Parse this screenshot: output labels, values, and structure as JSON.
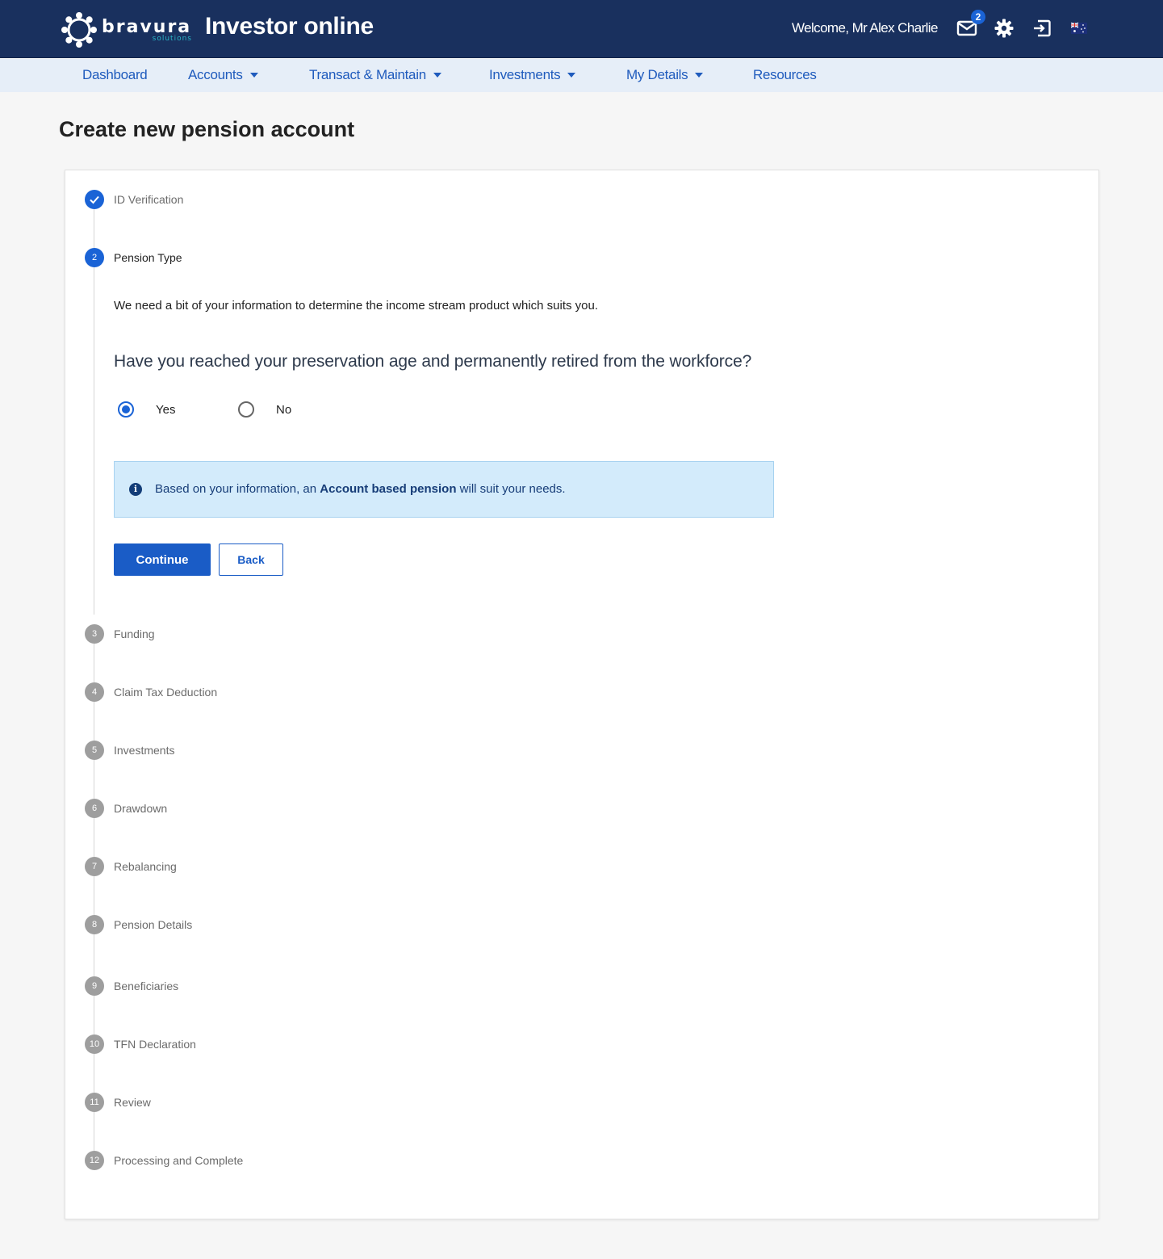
{
  "header": {
    "logo_name": "bravura",
    "logo_sub": "solutions",
    "app_title": "Investor online",
    "welcome": "Welcome, Mr Alex Charlie",
    "mail_count": "2",
    "icons": [
      "mail-icon",
      "gear-icon",
      "logout-icon",
      "australia-flag-icon"
    ]
  },
  "nav": {
    "items": [
      {
        "label": "Dashboard",
        "dropdown": false
      },
      {
        "label": "Accounts",
        "dropdown": true
      },
      {
        "label": "Transact & Maintain",
        "dropdown": true
      },
      {
        "label": "Investments",
        "dropdown": true
      },
      {
        "label": "My Details",
        "dropdown": true
      },
      {
        "label": "Resources",
        "dropdown": false
      }
    ]
  },
  "page": {
    "title": "Create new pension account"
  },
  "stepper": {
    "steps": [
      {
        "number": "1",
        "label": "ID Verification",
        "state": "done"
      },
      {
        "number": "2",
        "label": "Pension Type",
        "state": "active"
      },
      {
        "number": "3",
        "label": "Funding",
        "state": "pending"
      },
      {
        "number": "4",
        "label": "Claim Tax Deduction",
        "state": "pending"
      },
      {
        "number": "5",
        "label": "Investments",
        "state": "pending"
      },
      {
        "number": "6",
        "label": "Drawdown",
        "state": "pending"
      },
      {
        "number": "7",
        "label": "Rebalancing",
        "state": "pending"
      },
      {
        "number": "8",
        "label": "Pension Details",
        "state": "pending"
      },
      {
        "number": "9",
        "label": "Beneficiaries",
        "state": "pending"
      },
      {
        "number": "10",
        "label": "TFN Declaration",
        "state": "pending"
      },
      {
        "number": "11",
        "label": "Review",
        "state": "pending"
      },
      {
        "number": "12",
        "label": "Processing and Complete",
        "state": "pending"
      }
    ]
  },
  "form": {
    "intro": "We need a bit of your information to determine the income stream product which suits you.",
    "question": "Have you reached your preservation age and permanently retired from the workforce?",
    "options": [
      {
        "label": "Yes",
        "selected": true
      },
      {
        "label": "No",
        "selected": false
      }
    ],
    "info": {
      "prefix": "Based on your information, an ",
      "highlight": "Account based pension",
      "suffix": " will suit your needs."
    },
    "continue_label": "Continue",
    "back_label": "Back"
  },
  "colors": {
    "header_bg": "#19305e",
    "nav_bg": "#e6eef8",
    "accent": "#1a5cc6",
    "info_bg": "#d3ebfb",
    "step_pending": "#9e9e9e"
  }
}
